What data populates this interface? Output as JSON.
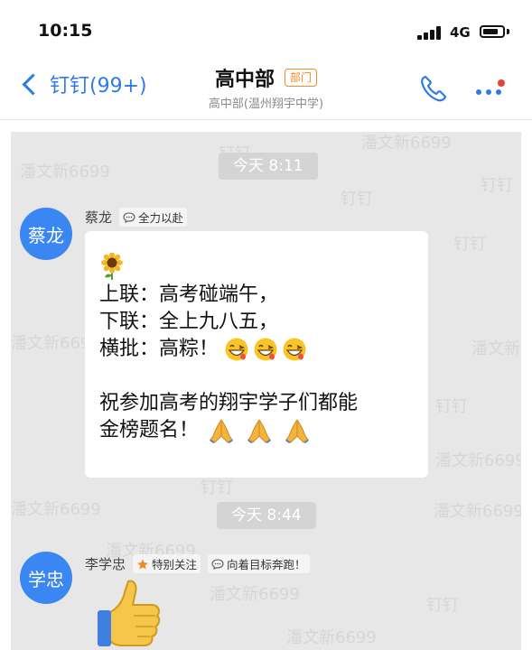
{
  "status_bar": {
    "time": "10:15",
    "network": "4G",
    "battery_level": 0.8
  },
  "nav": {
    "back_label": "钉钉(99+)",
    "title": "高中部",
    "tag": "部门",
    "subtitle": "高中部(温州翔宇中学)",
    "accent_color": "#2f7ae5"
  },
  "watermark_text": "潘文新6699",
  "watermark_app": "钉钉",
  "messages": [
    {
      "time_label": "今天 8:11",
      "avatar_text": "蔡龙",
      "sender_name": "蔡龙",
      "status": "全力以赴",
      "lines": [
        "上联：高考碰端午，",
        "下联：全上九八五，",
        "横批：高粽！",
        "祝参加高考的翔宇学子们都能",
        "金榜题名！"
      ],
      "icons": [
        "sunflower-icon",
        "grinning-face-icon",
        "folded-hands-icon"
      ]
    },
    {
      "time_label": "今天 8:44",
      "avatar_text": "学忠",
      "sender_name": "李学忠",
      "tag": "特别关注",
      "status": "向着目标奔跑！",
      "icons": [
        "star-icon",
        "thumbs-up-sticker"
      ]
    }
  ]
}
